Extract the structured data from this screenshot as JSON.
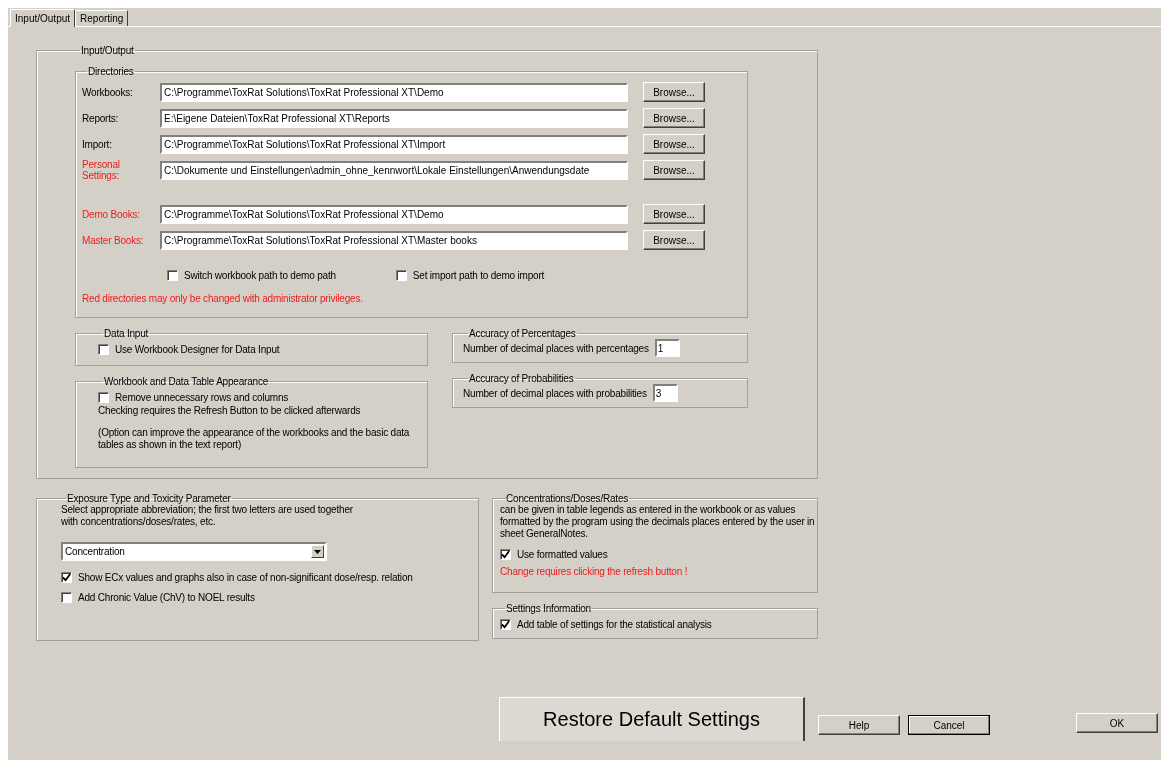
{
  "tabs": [
    {
      "label": "Input/Output",
      "selected": true
    },
    {
      "label": "Reporting",
      "selected": false
    }
  ],
  "input_output": {
    "title": "Input/Output",
    "directories": {
      "title": "Directories",
      "rows": [
        {
          "label": "Workbooks:",
          "value": "C:\\Programme\\ToxRat Solutions\\ToxRat Professional XT\\Demo",
          "restricted": false,
          "button": "Browse..."
        },
        {
          "label": "Reports:",
          "value": "E:\\Eigene Dateien\\ToxRat Professional XT\\Reports",
          "restricted": false,
          "button": "Browse..."
        },
        {
          "label": "Import:",
          "value": "C:\\Programme\\ToxRat Solutions\\ToxRat Professional XT\\Import",
          "restricted": false,
          "button": "Browse..."
        },
        {
          "label": "Personal Settings:",
          "value": "C:\\Dokumente und Einstellungen\\admin_ohne_kennwort\\Lokale Einstellungen\\Anwendungsdate",
          "restricted": true,
          "button": "Browse..."
        }
      ],
      "demo_rows": [
        {
          "label": "Demo Books:",
          "value": "C:\\Programme\\ToxRat Solutions\\ToxRat Professional XT\\Demo",
          "restricted": true,
          "button": "Browse..."
        },
        {
          "label": "Master Books:",
          "value": "C:\\Programme\\ToxRat Solutions\\ToxRat Professional XT\\Master books",
          "restricted": true,
          "button": "Browse..."
        }
      ],
      "options": [
        {
          "label": "Switch workbook path to demo path",
          "checked": false
        },
        {
          "label": "Set import path to demo import",
          "checked": false
        }
      ],
      "note": "Red directories may only be changed with administrator privileges."
    },
    "data_input": {
      "title": "Data Input",
      "option": {
        "label": "Use Workbook Designer for Data Input",
        "checked": false
      }
    },
    "appearance": {
      "title": "Workbook and Data Table Appearance",
      "option": {
        "label": "Remove unnecessary rows and columns",
        "checked": false
      },
      "hint": "Checking requires the Refresh Button to be clicked afterwards",
      "remark": "(Option can improve the appearance of the workbooks and the basic data tables as shown in the text report)"
    },
    "percentages": {
      "title": "Accuracy of Percentages",
      "label": "Number of decimal places with percentages",
      "value": "1"
    },
    "probabilities": {
      "title": "Accuracy of Probabilities",
      "label": "Number of decimal places with probabilities",
      "value": "3"
    }
  },
  "exposure": {
    "title": "Exposure Type and Toxicity Parameter",
    "description": "Select appropriate abbreviation; the first two letters are used together with concentrations/doses/rates, etc.",
    "selection": "Concentration",
    "options": [
      {
        "label": "Show ECx values and graphs also in case of non-significant dose/resp. relation",
        "checked": true
      },
      {
        "label": "Add Chronic Value (ChV) to NOEL results",
        "checked": false
      }
    ]
  },
  "concentrations": {
    "title": "Concentrations/Doses/Rates",
    "description": "can be given in table legends as entered in the workbook or as values formatted by the program using the decimals places entered by the user in sheet GeneralNotes.",
    "option": {
      "label": "Use formatted values",
      "checked": true
    },
    "warning": "Change requires clicking the refresh button !"
  },
  "settings_information": {
    "title": "Settings Information",
    "option": {
      "label": "Add table of settings for the statistical analysis",
      "checked": true
    }
  },
  "buttons": {
    "restore": "Restore Default Settings",
    "help": "Help",
    "cancel": "Cancel",
    "ok": "OK"
  }
}
